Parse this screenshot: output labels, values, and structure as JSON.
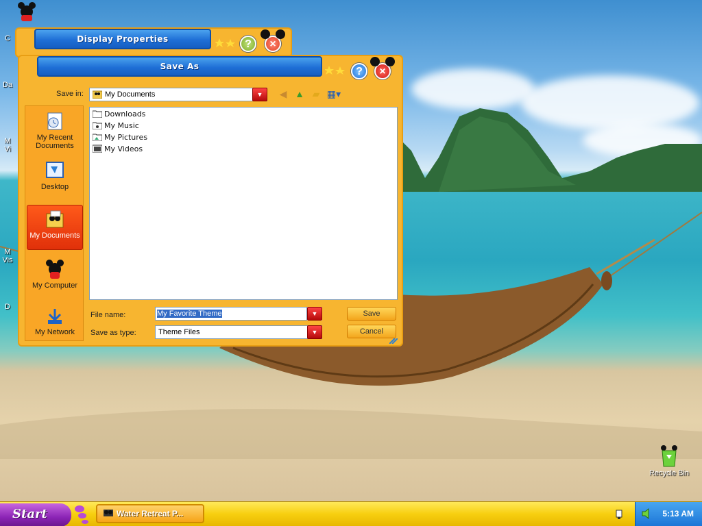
{
  "desktop": {
    "recycle_bin_label": "Recycle Bin",
    "partial_icon_labels": [
      "C",
      "Da",
      "M",
      "Vi",
      "M",
      "Vis",
      "D"
    ]
  },
  "display_properties_window": {
    "title": "Display Properties"
  },
  "save_dialog": {
    "title": "Save As",
    "save_in_label": "Save in:",
    "save_in_value": "My Documents",
    "places": [
      {
        "label": "My Recent Documents",
        "icon": "recent-documents-icon"
      },
      {
        "label": "Desktop",
        "icon": "desktop-icon"
      },
      {
        "label": "My Documents",
        "icon": "my-documents-icon",
        "selected": true
      },
      {
        "label": "My Computer",
        "icon": "my-computer-icon"
      },
      {
        "label": "My Network",
        "icon": "my-network-icon"
      }
    ],
    "files": [
      {
        "name": "Downloads",
        "icon": "folder-icon"
      },
      {
        "name": "My Music",
        "icon": "music-folder-icon"
      },
      {
        "name": "My Pictures",
        "icon": "pictures-folder-icon"
      },
      {
        "name": "My Videos",
        "icon": "videos-folder-icon"
      }
    ],
    "file_name_label": "File name:",
    "file_name_value": "My Favorite Theme",
    "save_as_type_label": "Save as type:",
    "save_as_type_value": "Theme Files",
    "save_button": "Save",
    "cancel_button": "Cancel"
  },
  "taskbar": {
    "start_label": "Start",
    "task_button_label": "Water Retreat P...",
    "clock": "5:13 AM"
  },
  "colors": {
    "window_orange": "#f7b530",
    "title_blue": "#1f6fd6",
    "selected_place": "#e0300a",
    "taskbar_yellow": "#f7cf10",
    "start_purple": "#8b24b5",
    "tray_blue": "#1b74d6"
  }
}
